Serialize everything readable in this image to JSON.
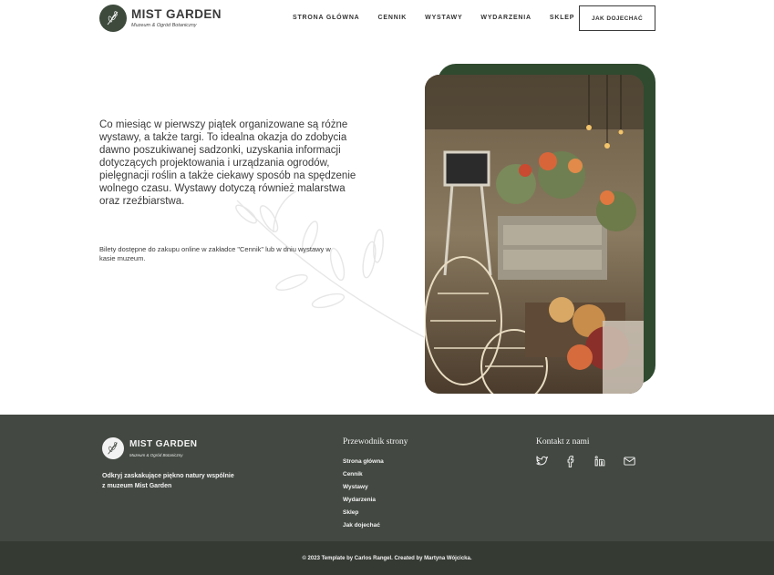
{
  "brand": {
    "name": "MIST GARDEN",
    "subtitle": "Muzeum & Ogród Botaniczny"
  },
  "nav": {
    "items": [
      "STRONA GŁÓWNA",
      "CENNIK",
      "WYSTAWY",
      "WYDARZENIA",
      "SKLEP"
    ],
    "cta_label": "JAK DOJECHAĆ"
  },
  "main": {
    "paragraph": "Co miesiąc w pierwszy piątek organizowane są różne wystawy, a także targi. To idealna okazja do zdobycia dawno poszukiwanej sadzonki, uzyskania informacji dotyczących projektowania i urządzania ogrodów, pielęgnacji roślin a także ciekawy sposób na spędzenie wolnego czasu. Wystawy dotyczą również malarstwa oraz rzeźbiarstwa.",
    "note": "Bilety dostępne do zakupu online w zakładce \"Cennik\" lub w dniu wystawy w kasie muzeum."
  },
  "footer": {
    "brand_name": "MIST GARDEN",
    "brand_subtitle": "Muzeum & Ogród Botaniczny",
    "description": "Odkryj zaskakujące piękno natury wspólnie z muzeum Mist Garden",
    "guide_title": "Przewodnik strony",
    "guide_links": [
      "Strona główna",
      "Cennik",
      "Wystawy",
      "Wydarzenia",
      "Sklep",
      "Jak dojechać"
    ],
    "contact_title": "Kontakt z nami",
    "socials": [
      "twitter-icon",
      "facebook-icon",
      "linkedin-icon",
      "mail-icon"
    ],
    "copyright": "© 2023 Template by Carlos Rangel. Created by Martyna Wójcicka."
  },
  "colors": {
    "dark_green": "#2f4a2f",
    "footer_bg": "#434942",
    "copyright_bg": "#353a33"
  }
}
